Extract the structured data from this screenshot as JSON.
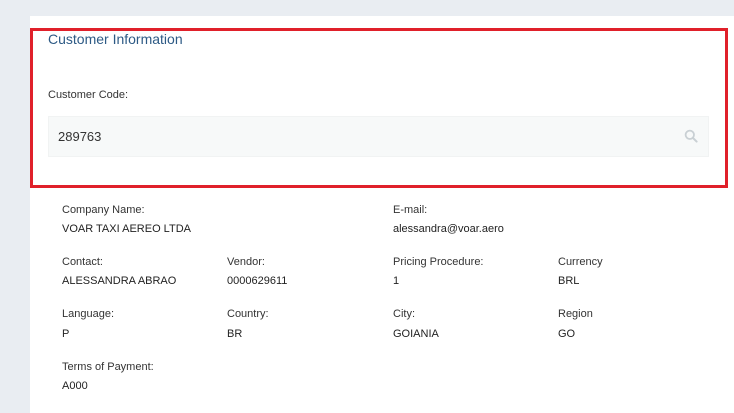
{
  "section": {
    "title": "Customer Information",
    "customer_code_label": "Customer Code:",
    "customer_code_value": "289763"
  },
  "details": {
    "company_name": {
      "label": "Company Name:",
      "value": "VOAR TAXI AEREO LTDA"
    },
    "email": {
      "label": "E-mail:",
      "value": "alessandra@voar.aero"
    },
    "contact": {
      "label": "Contact:",
      "value": "ALESSANDRA ABRAO"
    },
    "vendor": {
      "label": "Vendor:",
      "value": "0000629611"
    },
    "pricing_procedure": {
      "label": "Pricing Procedure:",
      "value": "1"
    },
    "currency": {
      "label": "Currency",
      "value": "BRL"
    },
    "language": {
      "label": "Language:",
      "value": "P"
    },
    "country": {
      "label": "Country:",
      "value": "BR"
    },
    "city": {
      "label": "City:",
      "value": "GOIANIA"
    },
    "region": {
      "label": "Region",
      "value": "GO"
    },
    "terms_of_payment": {
      "label": "Terms of Payment:",
      "value": "A000"
    }
  },
  "colors": {
    "highlight_border": "#e0202a",
    "title": "#2d5a85",
    "background": "#e9edf2"
  },
  "icons": {
    "search": "search-icon"
  }
}
